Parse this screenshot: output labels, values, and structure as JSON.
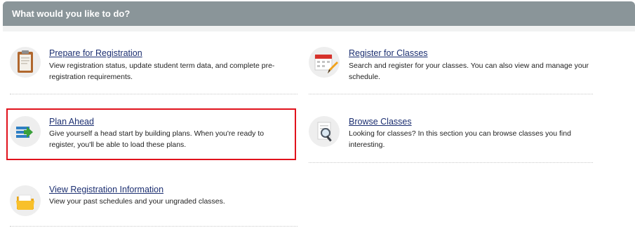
{
  "header": {
    "title": "What would you like to do?"
  },
  "tiles": [
    {
      "title": "Prepare for Registration",
      "description": "View registration status, update student term data, and complete pre-registration requirements.",
      "icon": "clipboard-icon"
    },
    {
      "title": "Register for Classes",
      "description": "Search and register for your classes. You can also view and manage your schedule.",
      "icon": "calendar-pencil-icon"
    },
    {
      "title": "Plan Ahead",
      "description": "Give yourself a head start by building plans. When you're ready to register, you'll be able to load these plans.",
      "icon": "plan-list-arrow-icon"
    },
    {
      "title": "Browse Classes",
      "description": "Looking for classes? In this section you can browse classes you find interesting.",
      "icon": "magnifier-document-icon"
    },
    {
      "title": "View Registration Information",
      "description": "View your past schedules and your ungraded classes.",
      "icon": "folder-icon"
    }
  ],
  "colors": {
    "header_bg": "#8a9599",
    "link": "#1c2f71",
    "highlight": "#e1121c"
  }
}
